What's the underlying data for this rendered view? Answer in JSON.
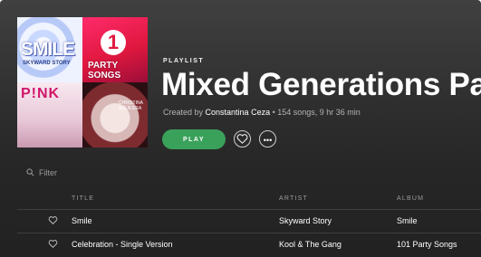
{
  "cover": {
    "tiles": [
      {
        "name": "smile-skyward-story-cover",
        "text": "SMILE",
        "sub": "SKYWARD STORY"
      },
      {
        "name": "party-songs-cover",
        "text": "PARTY SONGS"
      },
      {
        "name": "pink-cover",
        "text": "P!NK"
      },
      {
        "name": "christina-aguilera-cover",
        "text": "CHRISTINA AGUILERA"
      }
    ]
  },
  "header": {
    "type_label": "PLAYLIST",
    "title": "Mixed Generations Party",
    "created_by_prefix": "Created by ",
    "owner": "Constantina Ceza",
    "stats": " • 154 songs, 9 hr 36 min"
  },
  "actions": {
    "play_label": "PLAY",
    "heart_icon": "heart-outline",
    "more_icon": "ellipsis"
  },
  "filter": {
    "placeholder": "Filter",
    "icon": "search"
  },
  "table": {
    "columns": [
      "TITLE",
      "ARTIST",
      "ALBUM"
    ],
    "rows": [
      {
        "title": "Smile",
        "artist": "Skyward Story",
        "album": "Smile"
      },
      {
        "title": "Celebration - Single Version",
        "artist": "Kool & The Gang",
        "album": "101 Party Songs"
      }
    ]
  },
  "colors": {
    "background": "#2e2e2e",
    "play_green": "#3aa15a",
    "text_primary": "#ffffff",
    "text_secondary": "#b3b3b3"
  }
}
